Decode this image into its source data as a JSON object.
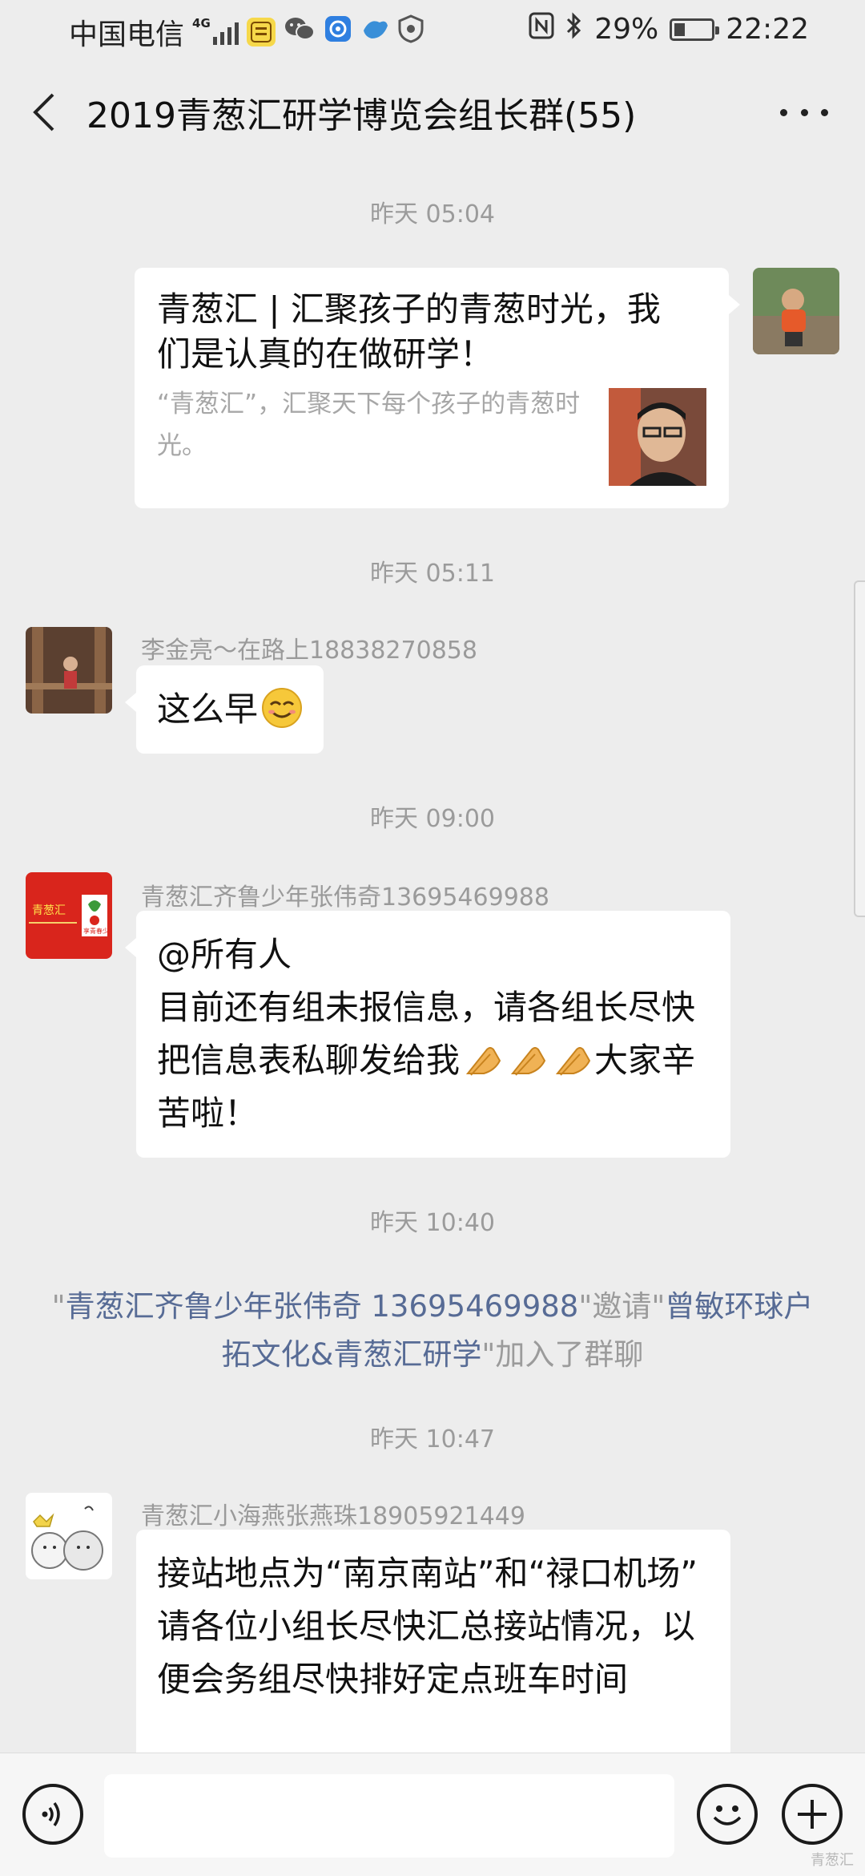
{
  "status_bar": {
    "carrier": "中国电信",
    "network": "4G",
    "app_badge": "追阅小说",
    "battery": "29%",
    "battery_level": 0.29,
    "time": "22:22"
  },
  "header": {
    "title": "2019青葱汇研学博览会组长群(55)"
  },
  "messages": {
    "t1": "昨天 05:04",
    "card": {
      "title": "青葱汇 | 汇聚孩子的青葱时光，我们是认真的在做研学！",
      "desc": "“青葱汇”，汇聚天下每个孩子的青葱时光。"
    },
    "t2": "昨天 05:11",
    "m2": {
      "sender": "李金亮～在路上18838270858",
      "text": "这么早"
    },
    "t3": "昨天 09:00",
    "m3": {
      "sender": "青葱汇齐鲁少年张伟奇13695469988",
      "line1": "@所有人",
      "line2": "目前还有组未报信息，请各组长尽快把信息表私聊发给我",
      "line3": "大家辛苦啦！"
    },
    "t4": "昨天 10:40",
    "system": {
      "q1": "\"",
      "inviter": "青葱汇齐鲁少年张伟奇 13695469988",
      "mid": "\"邀请\"",
      "invitee": "曾敏环球户拓文化&青葱汇研学",
      "end": "\"加入了群聊"
    },
    "t5": "昨天 10:47",
    "m5": {
      "sender": "青葱汇小海燕张燕珠18905921449",
      "line1": "接站地点为“南京南站”和“禄口机场”",
      "line2": "请各位小组长尽快汇总接站情况，以便会务组尽快排好定点班车时间"
    }
  },
  "input_bar": {
    "placeholder": ""
  },
  "avatar_badge": {
    "line1": "青葱汇",
    "line2": "享青春少年"
  },
  "watermark": "青葱汇"
}
